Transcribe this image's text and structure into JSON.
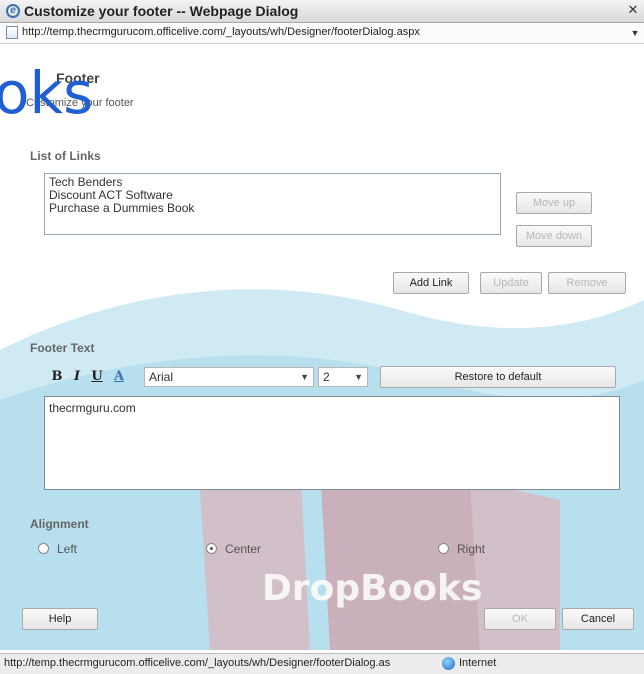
{
  "window": {
    "title": "Customize your footer -- Webpage Dialog",
    "url": "http://temp.thecrmgurucom.officelive.com/_layouts/wh/Designer/footerDialog.aspx"
  },
  "header": {
    "title": "Footer",
    "subtitle": "Customize your footer",
    "watermark": "oks"
  },
  "links_section": {
    "label": "List of Links",
    "items": [
      "Tech Benders",
      "Discount ACT Software",
      "Purchase a Dummies Book"
    ],
    "move_up": "Move up",
    "move_down": "Move down",
    "add_link": "Add Link",
    "update": "Update",
    "remove": "Remove"
  },
  "footer_text_section": {
    "label": "Footer Text",
    "bold": "B",
    "italic": "I",
    "underline": "U",
    "font_color": "A",
    "font_family": "Arial",
    "font_size": "2",
    "restore": "Restore to default",
    "content": "thecrmguru.com"
  },
  "alignment_section": {
    "label": "Alignment",
    "options": [
      {
        "label": "Left",
        "checked": false
      },
      {
        "label": "Center",
        "checked": true
      },
      {
        "label": "Right",
        "checked": false
      }
    ]
  },
  "actions": {
    "help": "Help",
    "ok": "OK",
    "cancel": "Cancel"
  },
  "status": {
    "url": "http://temp.thecrmgurucom.officelive.com/_layouts/wh/Designer/footerDialog.as",
    "zone": "Internet"
  },
  "background_watermark": "DropBooks",
  "colors": {
    "wave": "#bfe3ee",
    "book_red": "#c0392b",
    "watermark_blue": "#1f5fd1"
  }
}
